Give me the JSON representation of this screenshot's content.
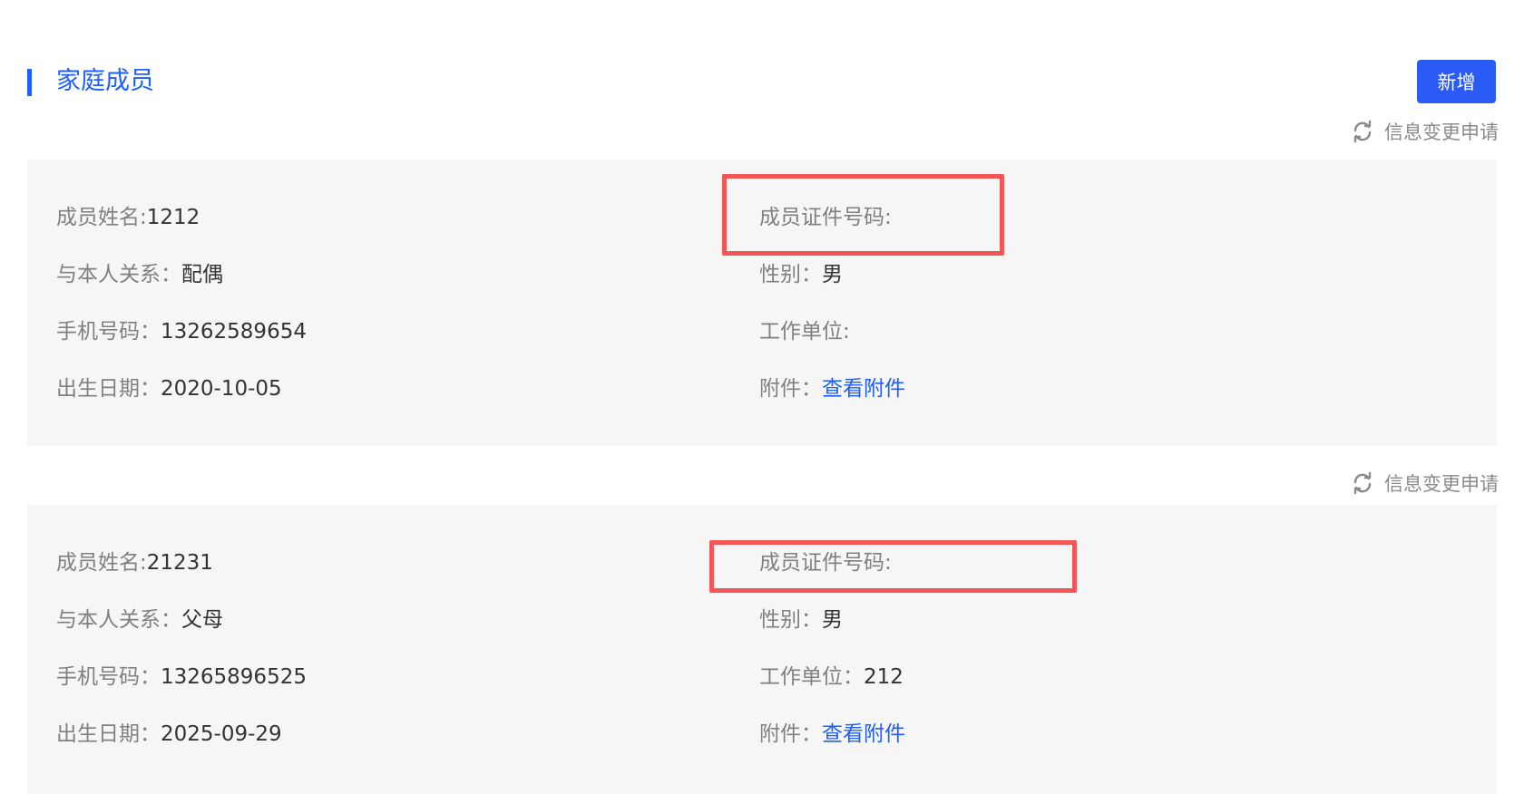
{
  "section": {
    "title": "家庭成员",
    "add_button_label": "新增",
    "change_request_label": "信息变更申请"
  },
  "colors": {
    "accent": "#1e5eff",
    "button": "#2a5cf5",
    "card_background": "#f6f6f6",
    "highlight": "#f25656",
    "label": "#808080",
    "value": "#333333"
  },
  "labels": {
    "name": "成员姓名:",
    "relation": "与本人关系：",
    "phone": "手机号码：",
    "birth": "出生日期：",
    "id_number": "成员证件号码:",
    "gender": "性别：",
    "work_unit": "工作单位:",
    "work_unit_filled": "工作单位：",
    "attachment": "附件：",
    "view_attachment": "查看附件"
  },
  "members": [
    {
      "name": "1212",
      "relation": "配偶",
      "phone": "13262589654",
      "birth_date": "2020-10-05",
      "id_number": "",
      "gender": "男",
      "work_unit": ""
    },
    {
      "name": "21231",
      "relation": "父母",
      "phone": "13265896525",
      "birth_date": "2025-09-29",
      "id_number": "",
      "gender": "男",
      "work_unit": "212"
    }
  ]
}
